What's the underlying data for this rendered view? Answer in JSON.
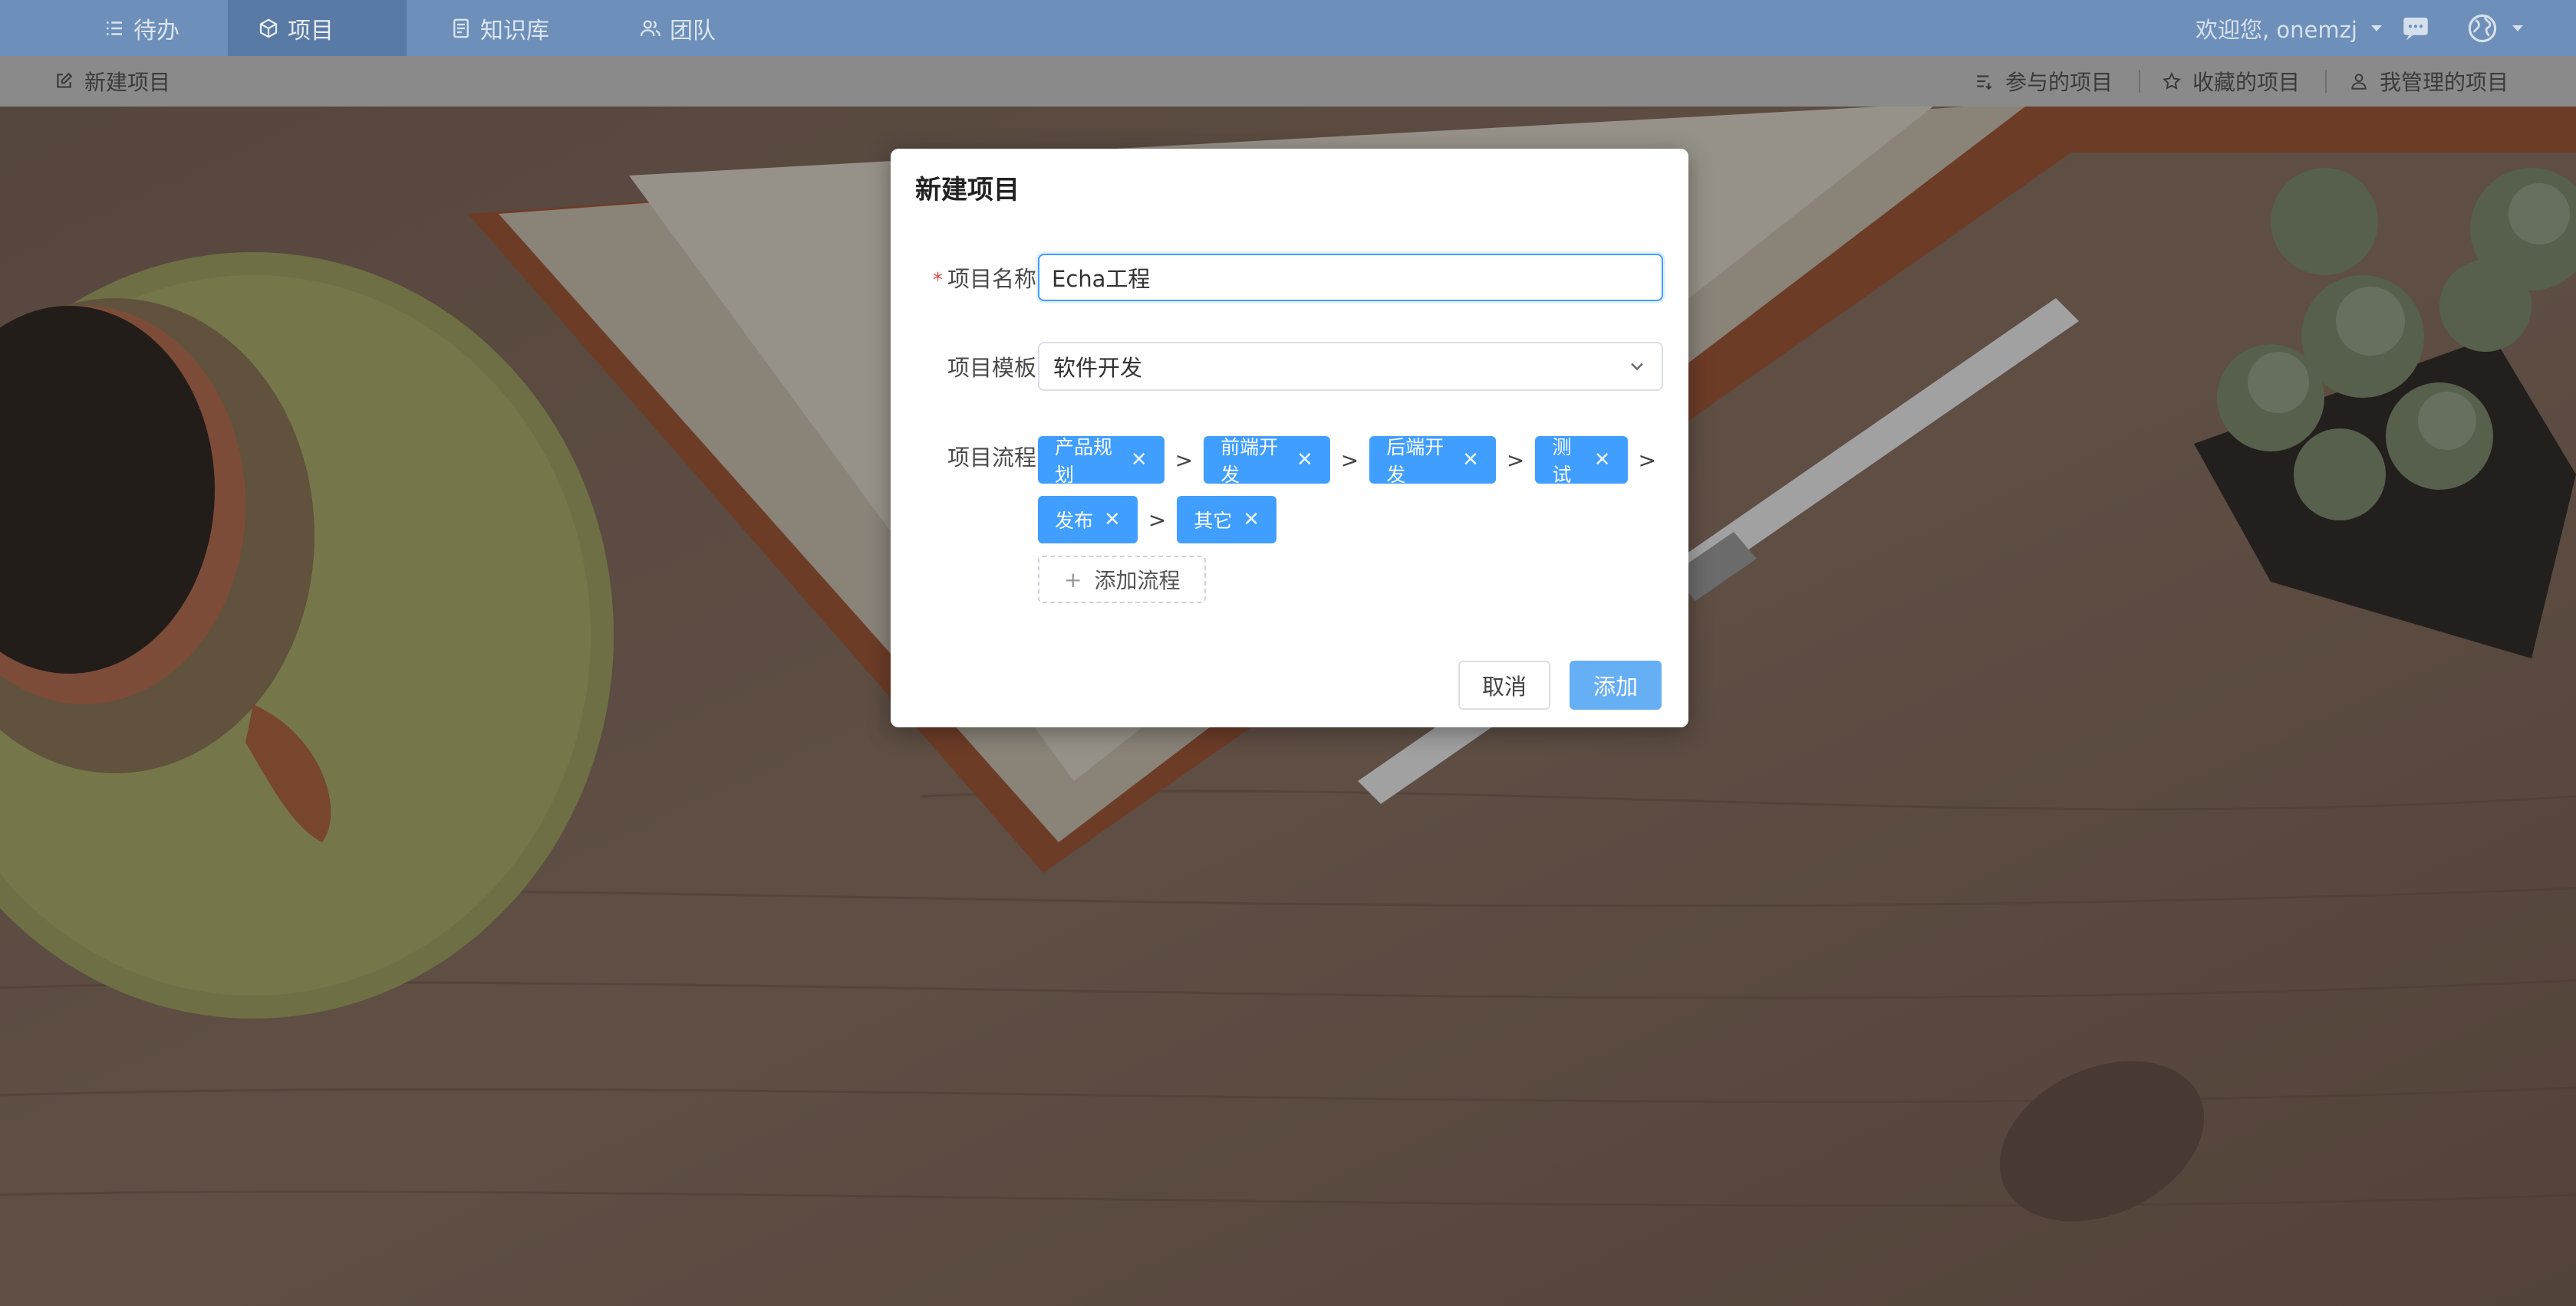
{
  "nav": {
    "items": [
      {
        "label": "待办",
        "icon": "list-icon"
      },
      {
        "label": "项目",
        "icon": "cube-icon"
      },
      {
        "label": "知识库",
        "icon": "document-icon"
      },
      {
        "label": "团队",
        "icon": "team-icon"
      }
    ],
    "welcome": "欢迎您, onemzj",
    "message_icon": "message-icon",
    "globe_icon": "globe-icon"
  },
  "subbar": {
    "new_project": "新建项目",
    "participated": "参与的项目",
    "favorites": "收藏的项目",
    "managed": "我管理的项目"
  },
  "modal": {
    "title": "新建项目",
    "name_label": "项目名称",
    "name_value": "Echa工程",
    "template_label": "项目模板",
    "template_value": "软件开发",
    "flow_label": "项目流程",
    "flow_tags": [
      "产品规划",
      "前端开发",
      "后端开发",
      "测试",
      "发布",
      "其它"
    ],
    "flow_separator": ">",
    "add_flow": "添加流程",
    "cancel": "取消",
    "add": "添加"
  }
}
